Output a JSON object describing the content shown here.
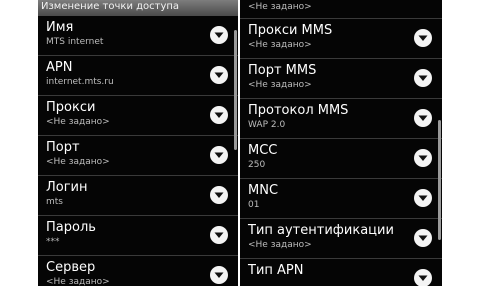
{
  "left": {
    "title": "Изменение точки доступа",
    "items": [
      {
        "title": "Имя",
        "summary": "MTS internet"
      },
      {
        "title": "APN",
        "summary": "internet.mts.ru"
      },
      {
        "title": "Прокси",
        "summary": "<Не задано>"
      },
      {
        "title": "Порт",
        "summary": "<Не задано>"
      },
      {
        "title": "Логин",
        "summary": "mts"
      },
      {
        "title": "Пароль",
        "summary": "***"
      },
      {
        "title": "Сервер",
        "summary": "<Не задано>"
      }
    ]
  },
  "right": {
    "top_summary": "<Не задано>",
    "items": [
      {
        "title": "Прокси MMS",
        "summary": "<Не задано>"
      },
      {
        "title": "Порт MMS",
        "summary": "<Не задано>"
      },
      {
        "title": "Протокол MMS",
        "summary": "WAP 2.0"
      },
      {
        "title": "MCC",
        "summary": "250"
      },
      {
        "title": "MNC",
        "summary": "01"
      },
      {
        "title": "Тип аутентификации",
        "summary": "<Не задано>"
      },
      {
        "title": "Тип APN",
        "summary": ""
      }
    ]
  },
  "icons": {
    "dropdown": "chevron-down-circle-icon"
  }
}
